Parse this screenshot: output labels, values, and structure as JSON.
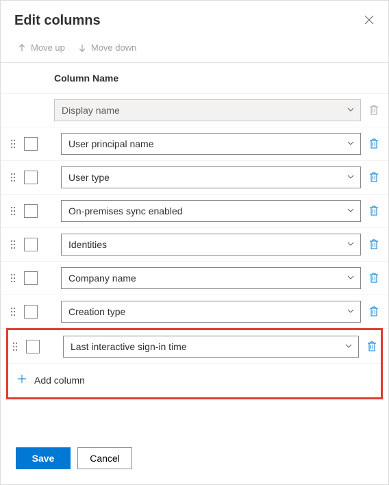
{
  "title": "Edit columns",
  "toolbar": {
    "move_up_label": "Move up",
    "move_down_label": "Move down"
  },
  "list_header": "Column Name",
  "locked_column": {
    "value": "Display name"
  },
  "columns": [
    {
      "value": "User principal name"
    },
    {
      "value": "User type"
    },
    {
      "value": "On-premises sync enabled"
    },
    {
      "value": "Identities"
    },
    {
      "value": "Company name"
    },
    {
      "value": "Creation type"
    },
    {
      "value": "Last interactive sign-in time",
      "highlighted": true
    }
  ],
  "add_column_label": "Add column",
  "footer": {
    "save_label": "Save",
    "cancel_label": "Cancel"
  },
  "colors": {
    "primary": "#0078d4",
    "highlight_border": "#e03c31"
  }
}
